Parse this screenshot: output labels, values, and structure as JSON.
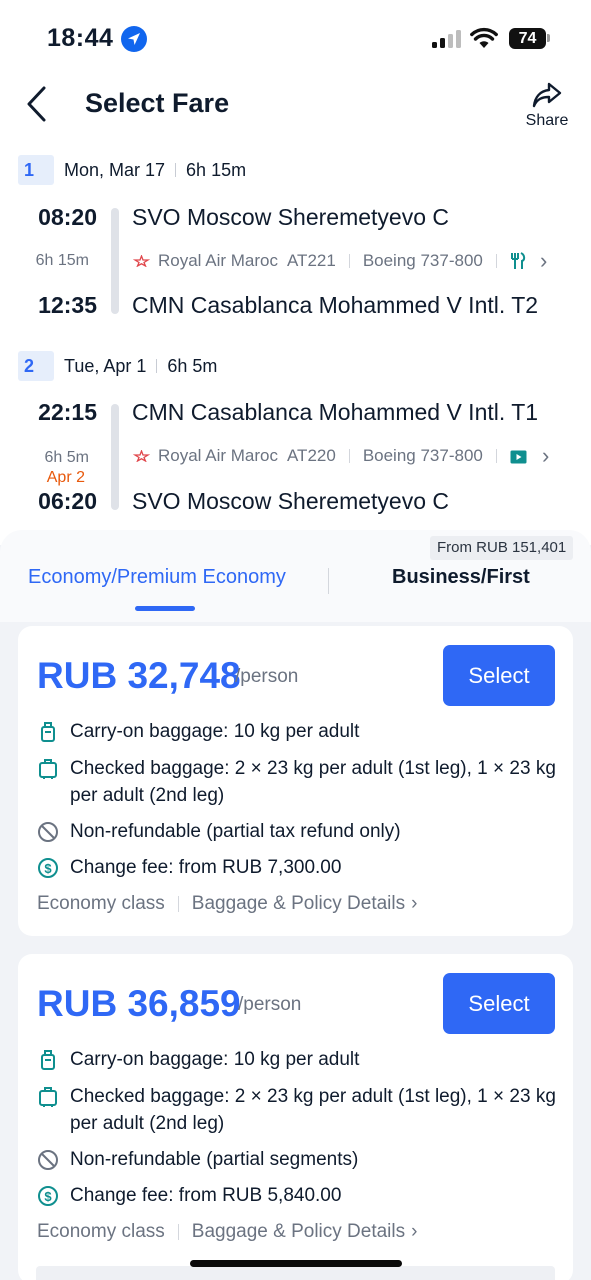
{
  "status_bar": {
    "time": "18:44",
    "battery": "74"
  },
  "header": {
    "title": "Select Fare",
    "share_label": "Share"
  },
  "legs": [
    {
      "number": "1",
      "date": "Mon, Mar 17",
      "duration": "6h 15m",
      "depart_time": "08:20",
      "arrive_time": "12:35",
      "flight_duration": "6h 15m",
      "next_day": "",
      "from": "SVO Moscow Sheremetyevo C",
      "to": "CMN Casablanca Mohammed V Intl. T2",
      "airline": "Royal Air Maroc",
      "flight_no": "AT221",
      "aircraft": "Boeing 737-800",
      "amenity_icon": "meal-icon"
    },
    {
      "number": "2",
      "date": "Tue, Apr 1",
      "duration": "6h 5m",
      "depart_time": "22:15",
      "arrive_time": "06:20",
      "flight_duration": "6h 5m",
      "next_day": "Apr 2",
      "from": "CMN Casablanca Mohammed V Intl. T1",
      "to": "SVO Moscow Sheremetyevo C",
      "airline": "Royal Air Maroc",
      "flight_no": "AT220",
      "aircraft": "Boeing 737-800",
      "amenity_icon": "entertainment-icon"
    }
  ],
  "tabs": {
    "economy": "Economy/Premium Economy",
    "business": "Business/First",
    "business_badge": "From RUB 151,401",
    "active": "economy"
  },
  "fares": [
    {
      "price": "RUB 32,748",
      "per": "/person",
      "select_label": "Select",
      "carry_on": "Carry-on baggage: 10 kg per adult",
      "checked": "Checked baggage: 2 × 23 kg per adult (1st leg), 1 × 23 kg per adult (2nd leg)",
      "refund": "Non-refundable (partial tax refund only)",
      "change_fee": "Change fee: from RUB 7,300.00",
      "cabin": "Economy class",
      "policy_link": "Baggage & Policy Details"
    },
    {
      "price": "RUB 36,859",
      "per": "/person",
      "select_label": "Select",
      "carry_on": "Carry-on baggage: 10 kg per adult",
      "checked": "Checked baggage: 2 × 23 kg per adult (1st leg), 1 × 23 kg per adult (2nd leg)",
      "refund": "Non-refundable (partial segments)",
      "change_fee": "Change fee: from RUB 5,840.00",
      "cabin": "Economy class",
      "policy_link": "Baggage & Policy Details"
    }
  ],
  "colors": {
    "accent": "#2f68f5",
    "next_day": "#e8590c",
    "airline_logo": "#e0474c",
    "amenity": "#0f8f8f"
  }
}
